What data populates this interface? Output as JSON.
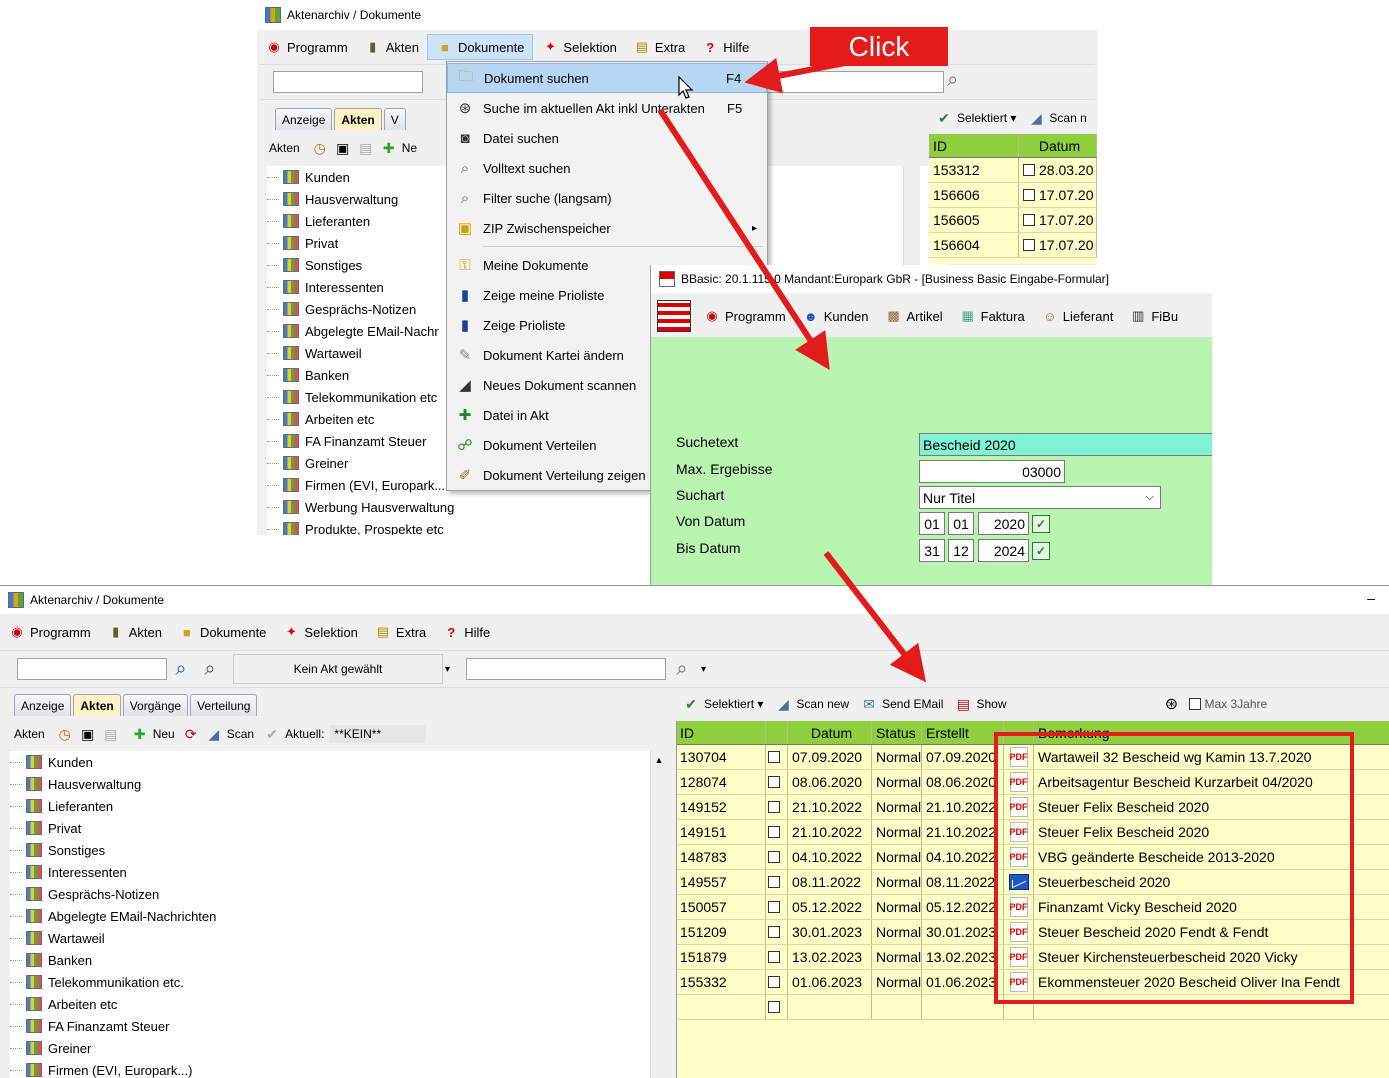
{
  "top_window": {
    "title": "Aktenarchiv / Dokumente",
    "menu": [
      "Programm",
      "Akten",
      "Dokumente",
      "Selektion",
      "Extra",
      "Hilfe"
    ],
    "tabs": [
      "Anzeige",
      "Akten",
      "V"
    ],
    "toolbar_left": [
      "Akten",
      "Ne"
    ],
    "tree": [
      "Kunden",
      "Hausverwaltung",
      "Lieferanten",
      "Privat",
      "Sonstiges",
      "Interessenten",
      "Gesprächs-Notizen",
      "Abgelegte EMail-Nachr",
      "Wartaweil",
      "Banken",
      "Telekommunikation etc",
      "Arbeiten etc",
      "FA Finanzamt Steuer",
      "Greiner",
      "Firmen (EVI, Europark...",
      "Werbung Hausverwaltung",
      "Produkte, Prospekte etc"
    ],
    "right_toolbar": [
      "Selektiert",
      "Scan n"
    ],
    "grid_headers": [
      "ID",
      "Datum"
    ],
    "grid_rows": [
      {
        "id": "153312",
        "date": "28.03.20"
      },
      {
        "id": "156606",
        "date": "17.07.20"
      },
      {
        "id": "156605",
        "date": "17.07.20"
      },
      {
        "id": "156604",
        "date": "17.07.20"
      }
    ]
  },
  "dropdown": {
    "items": [
      {
        "label": "Dokument suchen",
        "key": "F4",
        "icon": "folder-search-icon"
      },
      {
        "label": "Suche im aktuellen Akt inkl Unterakten",
        "key": "F5",
        "icon": "binoculars-icon"
      },
      {
        "label": "Datei suchen",
        "key": "",
        "icon": "camera-icon"
      },
      {
        "label": "Volltext suchen",
        "key": "",
        "icon": "magnifier-icon"
      },
      {
        "label": "Filter suche (langsam)",
        "key": "",
        "icon": "magnifier-icon"
      },
      {
        "label": "ZIP Zwischenspeicher",
        "key": "",
        "icon": "zip-icon"
      },
      {
        "label": "Meine Dokumente",
        "key": "",
        "icon": "key-icon"
      },
      {
        "label": "Zeige meine Prioliste",
        "key": "",
        "icon": "book-icon"
      },
      {
        "label": "Zeige Prioliste",
        "key": "",
        "icon": "book-icon"
      },
      {
        "label": "Dokument Kartei ändern",
        "key": "",
        "icon": "edit-icon"
      },
      {
        "label": "Neues Dokument scannen",
        "key": "",
        "icon": "scanner-icon"
      },
      {
        "label": "Datei in Akt",
        "key": "",
        "icon": "add-icon"
      },
      {
        "label": "Dokument Verteilen",
        "key": "",
        "icon": "share-icon"
      },
      {
        "label": "Dokument Verteilung zeigen",
        "key": "",
        "icon": "pen-icon"
      }
    ]
  },
  "callout": {
    "text": "Click"
  },
  "bbasic": {
    "title": "BBasic: 20.1.115.0 Mandant:Europark GbR  - [Business Basic Eingabe-Formular]",
    "menu": [
      "Programm",
      "Kunden",
      "Artikel",
      "Faktura",
      "Lieferant",
      "FiBu"
    ],
    "labels": {
      "suchetext": "Suchetext",
      "max": "Max. Ergebisse",
      "suchart": "Suchart",
      "von": "Von Datum",
      "bis": "Bis Datum"
    },
    "values": {
      "suchetext": "Bescheid 2020",
      "max": "03000",
      "suchart": "Nur Titel",
      "von_d": "01",
      "von_m": "01",
      "von_y": "2020",
      "bis_d": "31",
      "bis_m": "12",
      "bis_y": "2024"
    }
  },
  "bottom_window": {
    "title": "Aktenarchiv / Dokumente",
    "minimize": "–",
    "menu": [
      "Programm",
      "Akten",
      "Dokumente",
      "Selektion",
      "Extra",
      "Hilfe"
    ],
    "kein_akt": "Kein Akt gewählt",
    "tabs": [
      "Anzeige",
      "Akten",
      "Vorgänge",
      "Verteilung"
    ],
    "left_toolbar": {
      "akten": "Akten",
      "neu": "Neu",
      "scan": "Scan",
      "aktuell": "Aktuell:",
      "kein": "**KEIN**"
    },
    "right_toolbar": {
      "selektiert": "Selektiert",
      "scan_new": "Scan new",
      "send_email": "Send EMail",
      "show": "Show",
      "max3": "Max 3Jahre"
    },
    "tree": [
      "Kunden",
      "Hausverwaltung",
      "Lieferanten",
      "Privat",
      "Sonstiges",
      "Interessenten",
      "Gesprächs-Notizen",
      "Abgelegte EMail-Nachrichten",
      "Wartaweil",
      "Banken",
      "Telekommunikation etc.",
      "Arbeiten etc",
      "FA Finanzamt Steuer",
      "Greiner",
      "Firmen (EVI, Europark...)"
    ],
    "grid_headers": [
      "ID",
      "",
      "Datum",
      "Status",
      "Erstellt",
      "",
      "Bemerkung"
    ],
    "grid_rows": [
      {
        "id": "130704",
        "date": "07.09.2020",
        "status": "Normal",
        "created": "07.09.2020",
        "type": "pdf",
        "remark": "Wartaweil 32 Bescheid wg Kamin 13.7.2020"
      },
      {
        "id": "128074",
        "date": "08.06.2020",
        "status": "Normal",
        "created": "08.06.2020",
        "type": "pdf",
        "remark": "Arbeitsagentur Bescheid Kurzarbeit 04/2020"
      },
      {
        "id": "149152",
        "date": "21.10.2022",
        "status": "Normal",
        "created": "21.10.2022",
        "type": "pdf",
        "remark": "Steuer Felix Bescheid 2020"
      },
      {
        "id": "149151",
        "date": "21.10.2022",
        "status": "Normal",
        "created": "21.10.2022",
        "type": "pdf",
        "remark": "Steuer Felix Bescheid 2020"
      },
      {
        "id": "148783",
        "date": "04.10.2022",
        "status": "Normal",
        "created": "04.10.2022",
        "type": "pdf",
        "remark": "VBG geänderte Bescheide 2013-2020"
      },
      {
        "id": "149557",
        "date": "08.11.2022",
        "status": "Normal",
        "created": "08.11.2022",
        "type": "mail",
        "remark": "Steuerbescheid 2020"
      },
      {
        "id": "150057",
        "date": "05.12.2022",
        "status": "Normal",
        "created": "05.12.2022",
        "type": "pdf",
        "remark": "Finanzamt Vicky Bescheid 2020"
      },
      {
        "id": "151209",
        "date": "30.01.2023",
        "status": "Normal",
        "created": "30.01.2023",
        "type": "pdf",
        "remark": "Steuer Bescheid 2020 Fendt & Fendt"
      },
      {
        "id": "151879",
        "date": "13.02.2023",
        "status": "Normal",
        "created": "13.02.2023",
        "type": "pdf",
        "remark": "Steuer Kirchensteuerbescheid 2020 Vicky"
      },
      {
        "id": "155332",
        "date": "01.06.2023",
        "status": "Normal",
        "created": "01.06.2023",
        "type": "pdf",
        "remark": "Ekommensteuer 2020 Bescheid Oliver Ina Fendt"
      }
    ]
  },
  "colors": {
    "annotation_red": "#e41b1b",
    "grid_header": "#8fce3c",
    "grid_body": "#fefec8",
    "form_bg": "#b9f5b0",
    "highlight": "#b7d6f2"
  }
}
